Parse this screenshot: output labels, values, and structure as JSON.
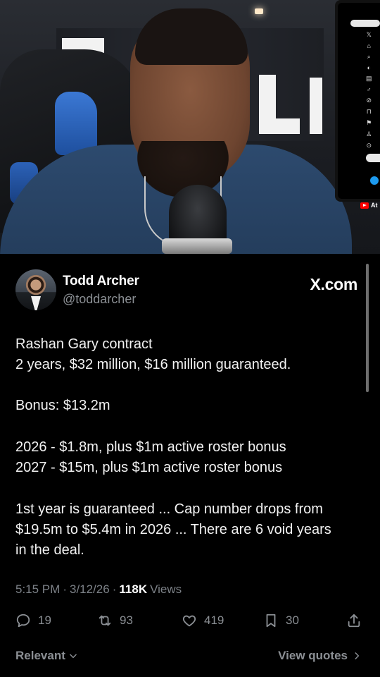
{
  "tweet": {
    "author_name": "Todd Archer",
    "author_handle": "@toddarcher",
    "site_badge": "X.com",
    "lines": [
      "Rashan Gary contract",
      "2 years, $32 million, $16 million guaranteed.",
      "Bonus: $13.2m",
      "2026 - $1.8m, plus $1m active roster bonus",
      "2027 - $15m, plus $1m active roster bonus",
      "1st year is guaranteed ... Cap number drops from",
      "$19.5m to $5.4m in 2026 ... There are 6 void years",
      "in the deal."
    ],
    "time": "5:15 PM",
    "date": "3/12/26",
    "views_count": "118K",
    "views_label": "Views",
    "replies": "19",
    "reposts": "93",
    "likes": "419",
    "bookmarks": "30",
    "filter_label": "Relevant",
    "quotes_label": "View quotes"
  },
  "video_overlay": {
    "yt_label": "At"
  },
  "icons": {
    "reply": "reply-icon",
    "repost": "repost-icon",
    "like": "heart-icon",
    "bookmark": "bookmark-icon",
    "share": "share-icon"
  }
}
